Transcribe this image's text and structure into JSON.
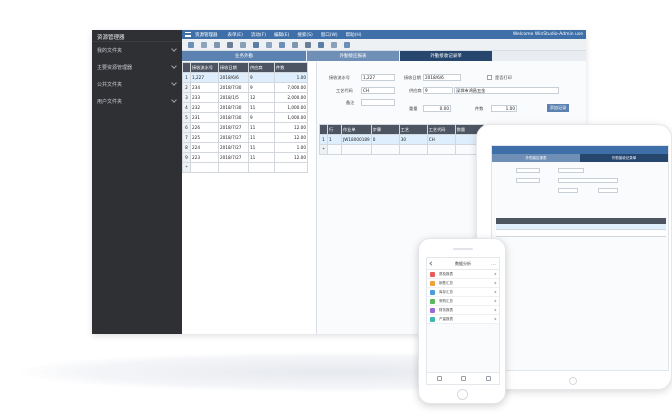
{
  "sidebar": {
    "title": "资源管理器",
    "items": [
      {
        "label": "我的文件夹"
      },
      {
        "label": "主要资源管理器"
      },
      {
        "label": "公共文件夹"
      },
      {
        "label": "用户文件夹"
      }
    ]
  },
  "topbar": {
    "title": "资源管理器",
    "menus": [
      "表单(E)",
      "流动(F)",
      "编辑(E)",
      "搜索(S)",
      "窗口(W)",
      "帮助(H)"
    ],
    "welcome": "Welcome WinStudio-Admin use"
  },
  "tabs": [
    "业务外勤",
    "外勤接应报表",
    "外勤接收记录单"
  ],
  "left_grid": {
    "headers": [
      "接收流水号",
      "接收日期",
      "供应商",
      "件数"
    ],
    "rows": [
      [
        "1,227",
        "2018/6/6",
        "9",
        "1.00"
      ],
      [
        "234",
        "2018/7/30",
        "9",
        "7,000.00"
      ],
      [
        "233",
        "2018/1/5",
        "12",
        "2,000.00"
      ],
      [
        "232",
        "2018/7/30",
        "11",
        "1,000.00"
      ],
      [
        "231",
        "2018/7/30",
        "9",
        "1,000.00"
      ],
      [
        "226",
        "2018/7/27",
        "11",
        "12.00"
      ],
      [
        "225",
        "2018/7/27",
        "11",
        "12.00"
      ],
      [
        "224",
        "2018/7/27",
        "11",
        "1.00"
      ],
      [
        "223",
        "2018/7/27",
        "11",
        "12.00"
      ]
    ],
    "row_numbers": [
      "1",
      "2",
      "3",
      "4",
      "5",
      "6",
      "7",
      "8",
      "9"
    ]
  },
  "form": {
    "receipt_no_label": "接收流水号",
    "receipt_no": "1,227",
    "receipt_date_label": "接收日期",
    "receipt_date": "2018/6/6",
    "print_label": "是否打印",
    "process_code_label": "工艺代码",
    "process_code": "CH",
    "supplier_label": "供应商",
    "supplier_no": "9",
    "supplier_name": "深圳市鸿昌五金",
    "remark_label": "备注",
    "weight_label": "重量",
    "weight": "0.00",
    "count_label": "件数",
    "count": "1.00",
    "button_label": "添加记录"
  },
  "detail_grid": {
    "headers": [
      "行",
      "作业单",
      "步骤",
      "工艺",
      "工艺代码",
      "数量"
    ],
    "row": [
      "1",
      "1",
      "JW18000189",
      "0",
      "30",
      "CH"
    ]
  },
  "tablet": {
    "tabs": [
      "外勤接应报表",
      "外勤接收记录单"
    ]
  },
  "phone": {
    "title": "数据分析",
    "items": [
      {
        "label": "质检报表",
        "color": "#e95b5b"
      },
      {
        "label": "销售汇总",
        "color": "#f0a23a"
      },
      {
        "label": "库存汇总",
        "color": "#4b9be0"
      },
      {
        "label": "采购汇总",
        "color": "#5cb85c"
      },
      {
        "label": "财务报表",
        "color": "#9b6ad8"
      },
      {
        "label": "产量报表",
        "color": "#3fb8b0"
      }
    ]
  },
  "colors": {
    "accent": "#3f6fa8",
    "sidebar_bg": "#2f3033",
    "header_bg": "#4e5562"
  }
}
